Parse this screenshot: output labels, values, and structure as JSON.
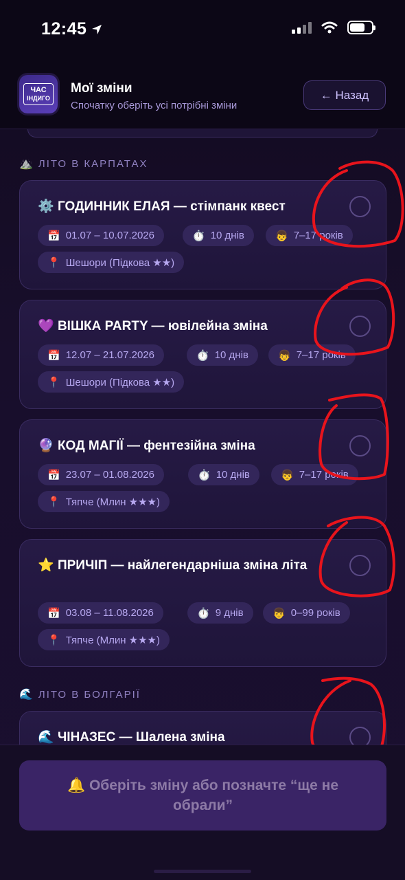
{
  "status_bar": {
    "time": "12:45"
  },
  "header": {
    "logo_line1": "ЧАС",
    "logo_line2": "ІНДИГО",
    "title": "Мої зміни",
    "subtitle": "Спочатку оберіть усі потрібні зміни",
    "back_label": "← Назад"
  },
  "sections": [
    {
      "icon": "⛰️",
      "label": "ЛІТО В КАРПАТАХ"
    },
    {
      "icon": "🌊",
      "label": "ЛІТО В БОЛГАРІЇ"
    }
  ],
  "cards": [
    {
      "emoji": "⚙️",
      "title": "ГОДИННИК ЕЛАЯ — стімпанк квест",
      "dates": "01.07 – 10.07.2026",
      "duration": "10 днів",
      "age": "7–17 років",
      "location": "Шешори (Підкова ★★)",
      "selected": false
    },
    {
      "emoji": "💜",
      "title": "ВІШКА PARTY — ювілейна зміна",
      "dates": "12.07 – 21.07.2026",
      "duration": "10 днів",
      "age": "7–17 років",
      "location": "Шешори (Підкова ★★)",
      "selected": false
    },
    {
      "emoji": "🔮",
      "title": "КОД МАГІЇ — фентезійна зміна",
      "dates": "23.07 – 01.08.2026",
      "duration": "10 днів",
      "age": "7–17 років",
      "location": "Тяпче (Млин ★★★)",
      "selected": false
    },
    {
      "emoji": "⭐",
      "title": "ПРИЧІП — найлегендарніша зміна літа",
      "dates": "03.08 – 11.08.2026",
      "duration": "9 днів",
      "age": "0–99 років",
      "location": "Тяпче (Млин ★★★)",
      "selected": false
    },
    {
      "emoji": "🌊",
      "title": "ЧІНАЗЕС — Шалена зміна",
      "selected": false
    }
  ],
  "chip_icons": {
    "dates": "📅",
    "duration": "⏱️",
    "age": "👦",
    "location": "📍"
  },
  "cta_label": "🔔 Оберіть зміну або позначте “ще не обрали”",
  "colors": {
    "annotation": "#e8141c",
    "accent": "#b7a8f0"
  }
}
